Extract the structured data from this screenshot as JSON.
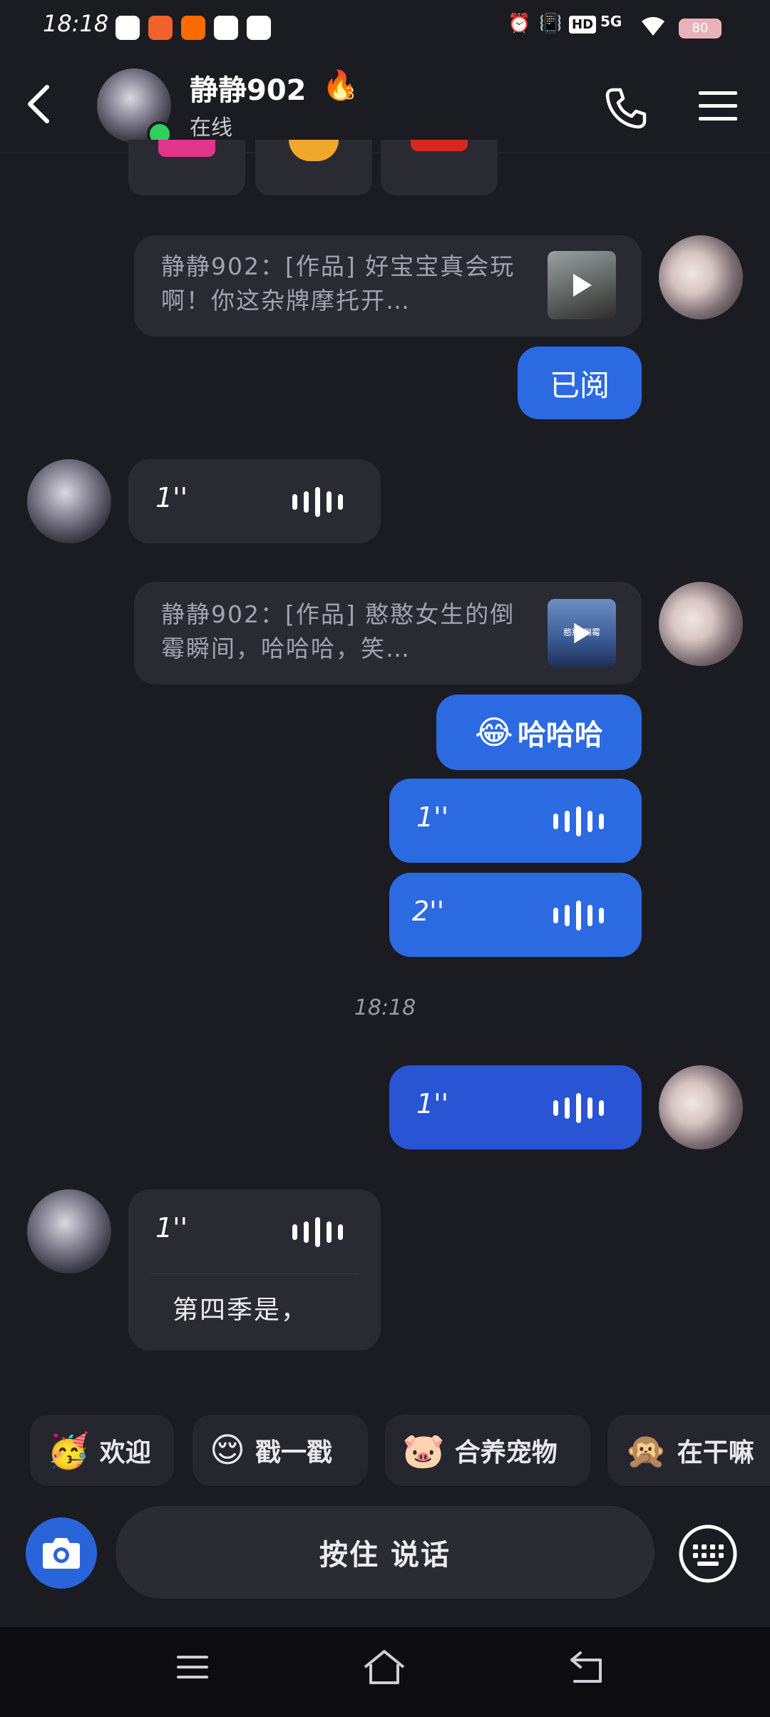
{
  "status_bar": {
    "time": "18:18",
    "battery": "80",
    "network": "5G",
    "hd": "HD"
  },
  "header": {
    "contact_name": "静静902",
    "streak_count": "3",
    "presence": "在线"
  },
  "messages": {
    "share1_text": "静静902：[作品] 好宝宝真会玩啊！你这杂牌摩托开…",
    "reply1": "已阅",
    "voice1_duration": "1''",
    "share2_text": "静静902：[作品] 憨憨女生的倒霉瞬间，哈哈哈，笑…",
    "share2_thumb_caption": "憨憨    倒霉",
    "reply2_emoji": "😂",
    "reply2_text": "哈哈哈",
    "voice2_duration": "1''",
    "voice3_duration": "2''",
    "timestamp": "18:18",
    "voice4_duration": "1''",
    "voice5_duration": "1''",
    "voice5_transcript": "第四季是，"
  },
  "quick_replies": [
    {
      "icon": "🥳",
      "label": "欢迎"
    },
    {
      "icon": "😌",
      "label": "戳一戳"
    },
    {
      "icon": "🐷",
      "label": "合养宠物"
    },
    {
      "icon": "🙊",
      "label": "在干嘛"
    }
  ],
  "input_bar": {
    "hold_to_talk": "按住 说话"
  },
  "colors": {
    "background": "#1b1b22",
    "bubble_blue": "#2c6ae2",
    "bubble_dark": "#2a2a33",
    "online": "#2bd15c"
  }
}
